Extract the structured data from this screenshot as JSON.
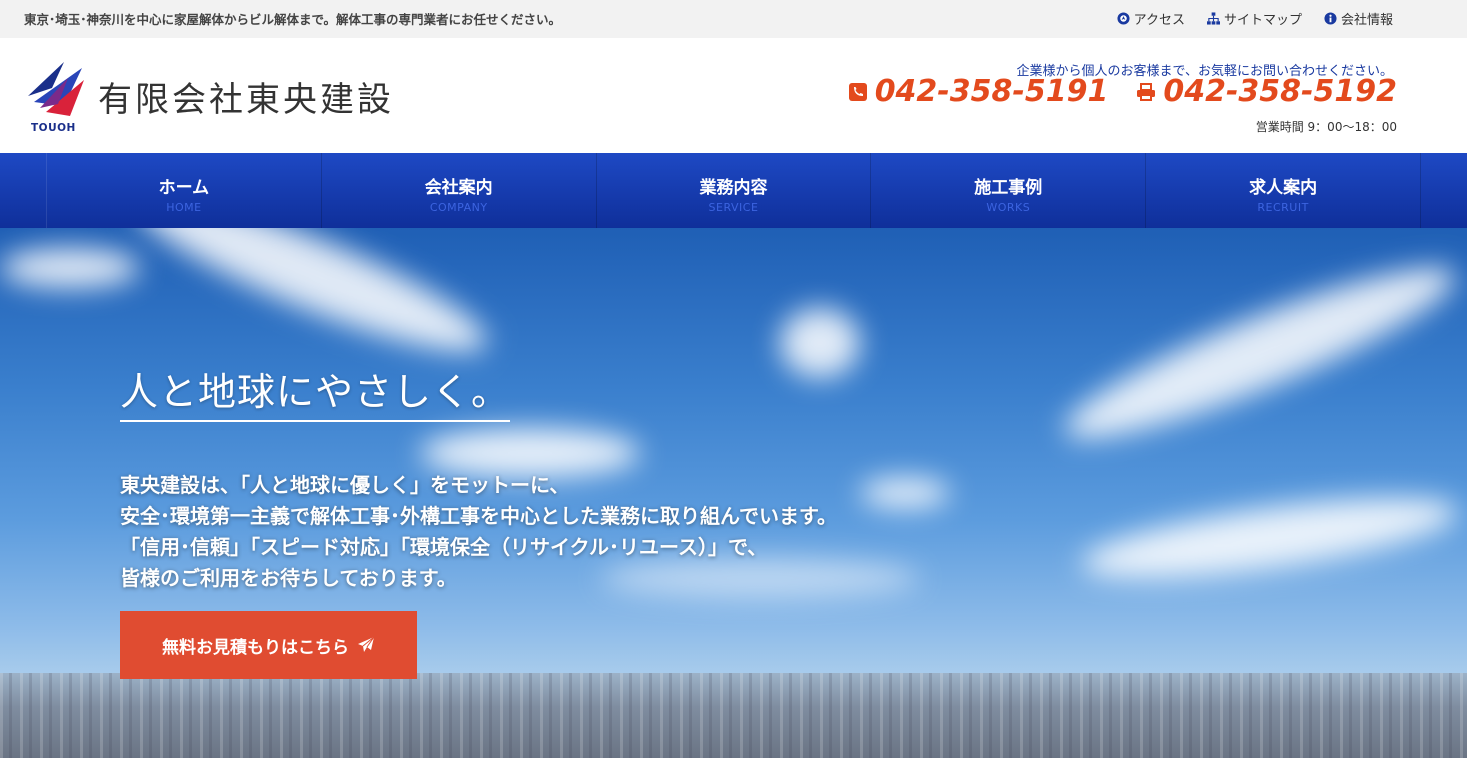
{
  "topbar": {
    "tagline": "東京･埼玉･神奈川を中心に家屋解体からビル解体まで。解体工事の専門業者にお任せください。",
    "links": [
      {
        "label": "アクセス",
        "icon": "location-icon"
      },
      {
        "label": "サイトマップ",
        "icon": "sitemap-icon"
      },
      {
        "label": "会社情報",
        "icon": "info-icon"
      }
    ]
  },
  "header": {
    "logo_caption": "TOUOH",
    "company_name": "有限会社東央建設",
    "contact_lead": "企業様から個人のお客様まで、お気軽にお問い合わせください。",
    "tel": "042-358-5191",
    "fax": "042-358-5192",
    "hours": "営業時間 9：00〜18：00"
  },
  "nav": [
    {
      "label": "ホーム",
      "sub": "HOME"
    },
    {
      "label": "会社案内",
      "sub": "COMPANY"
    },
    {
      "label": "業務内容",
      "sub": "SERVICE"
    },
    {
      "label": "施工事例",
      "sub": "WORKS"
    },
    {
      "label": "求人案内",
      "sub": "RECRUIT"
    }
  ],
  "hero": {
    "title": "人と地球にやさしく。",
    "lines": [
      "東央建設は、「人と地球に優しく」をモットーに、",
      "安全･環境第一主義で解体工事･外構工事を中心とした業務に取り組んでいます。",
      "「信用･信頼」「スピード対応」「環境保全（リサイクル･リユース）」で、",
      "皆様のご利用をお待ちしております。"
    ],
    "cta_label": "無料お見積もりはこちら"
  },
  "colors": {
    "brand_blue": "#1a3aa0",
    "nav_blue": "#1e49c4",
    "accent_orange": "#e34a1d",
    "cta_red": "#e04c31"
  }
}
